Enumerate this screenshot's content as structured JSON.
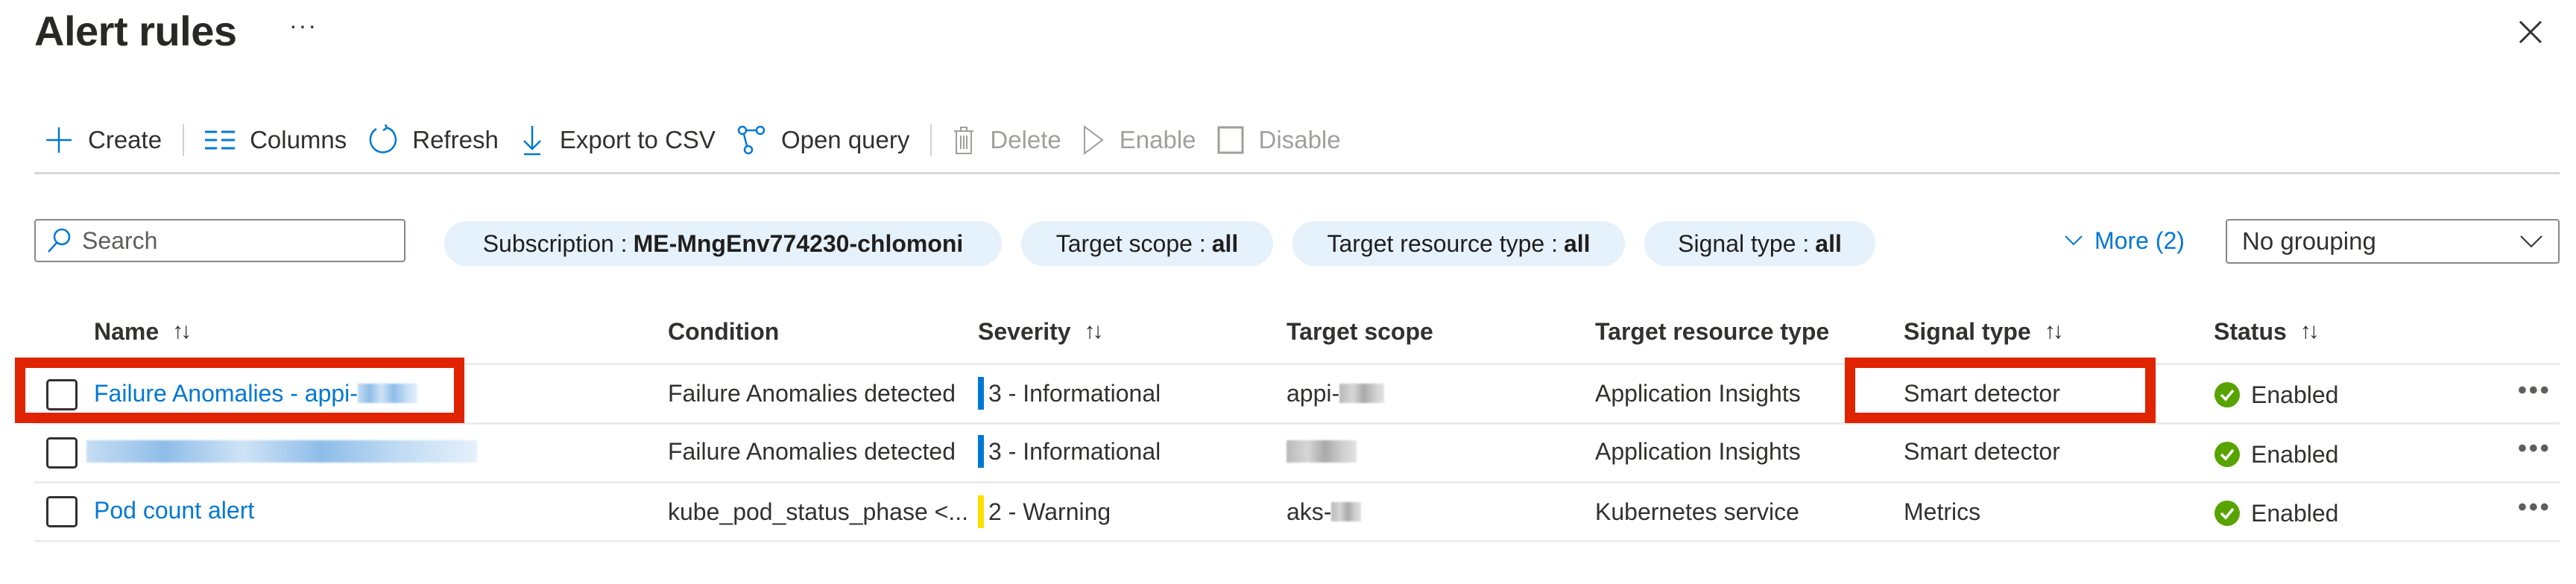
{
  "header": {
    "title": "Alert rules",
    "more_label": "···",
    "close_icon": "close-icon"
  },
  "toolbar": {
    "items": [
      {
        "label": "Create",
        "icon": "plus-icon",
        "enabled": true
      },
      {
        "label": "Columns",
        "icon": "columns-icon",
        "enabled": true
      },
      {
        "label": "Refresh",
        "icon": "refresh-icon",
        "enabled": true
      },
      {
        "label": "Export to CSV",
        "icon": "download-icon",
        "enabled": true
      },
      {
        "label": "Open query",
        "icon": "query-icon",
        "enabled": true
      },
      {
        "label": "Delete",
        "icon": "trash-icon",
        "enabled": false
      },
      {
        "label": "Enable",
        "icon": "play-icon",
        "enabled": false
      },
      {
        "label": "Disable",
        "icon": "stop-icon",
        "enabled": false
      }
    ]
  },
  "filters": {
    "search_placeholder": "Search",
    "pills": [
      {
        "label": "Subscription :",
        "value": "ME-MngEnv774230-chlomoni"
      },
      {
        "label": "Target scope :",
        "value": "all"
      },
      {
        "label": "Target resource type :",
        "value": "all"
      },
      {
        "label": "Signal type :",
        "value": "all"
      }
    ],
    "more_label": "More (2)",
    "grouping_value": "No grouping"
  },
  "table": {
    "columns": [
      {
        "label": "Name",
        "sortable": true
      },
      {
        "label": "Condition",
        "sortable": false
      },
      {
        "label": "Severity",
        "sortable": true
      },
      {
        "label": "Target scope",
        "sortable": false
      },
      {
        "label": "Target resource type",
        "sortable": false
      },
      {
        "label": "Signal type",
        "sortable": true
      },
      {
        "label": "Status",
        "sortable": true
      }
    ],
    "sort_glyph": "↑↓",
    "rows": [
      {
        "name": "Failure Anomalies - appi-",
        "name_redacted": true,
        "condition": "Failure Anomalies detected",
        "severity": "3 - Informational",
        "severity_color": "#0078d4",
        "target_scope": "appi-",
        "target_scope_redacted": true,
        "target_resource_type": "Application Insights",
        "signal_type": "Smart detector",
        "status": "Enabled",
        "highlighted": true
      },
      {
        "name": "",
        "name_redacted": true,
        "condition": "Failure Anomalies detected",
        "severity": "3 - Informational",
        "severity_color": "#0078d4",
        "target_scope": "",
        "target_scope_redacted": true,
        "target_resource_type": "Application Insights",
        "signal_type": "Smart detector",
        "status": "Enabled",
        "highlighted": false
      },
      {
        "name": "Pod count alert",
        "name_redacted": false,
        "condition": "kube_pod_status_phase <...",
        "severity": "2 - Warning",
        "severity_color": "#fce100",
        "target_scope": "aks-",
        "target_scope_redacted": true,
        "target_resource_type": "Kubernetes service",
        "signal_type": "Metrics",
        "status": "Enabled",
        "highlighted": false
      }
    ],
    "row_more_label": "•••"
  },
  "colors": {
    "accent": "#0078d4",
    "status_enabled": "#57a300",
    "highlight": "#e02401",
    "pill_bg": "#e5f1fb"
  }
}
